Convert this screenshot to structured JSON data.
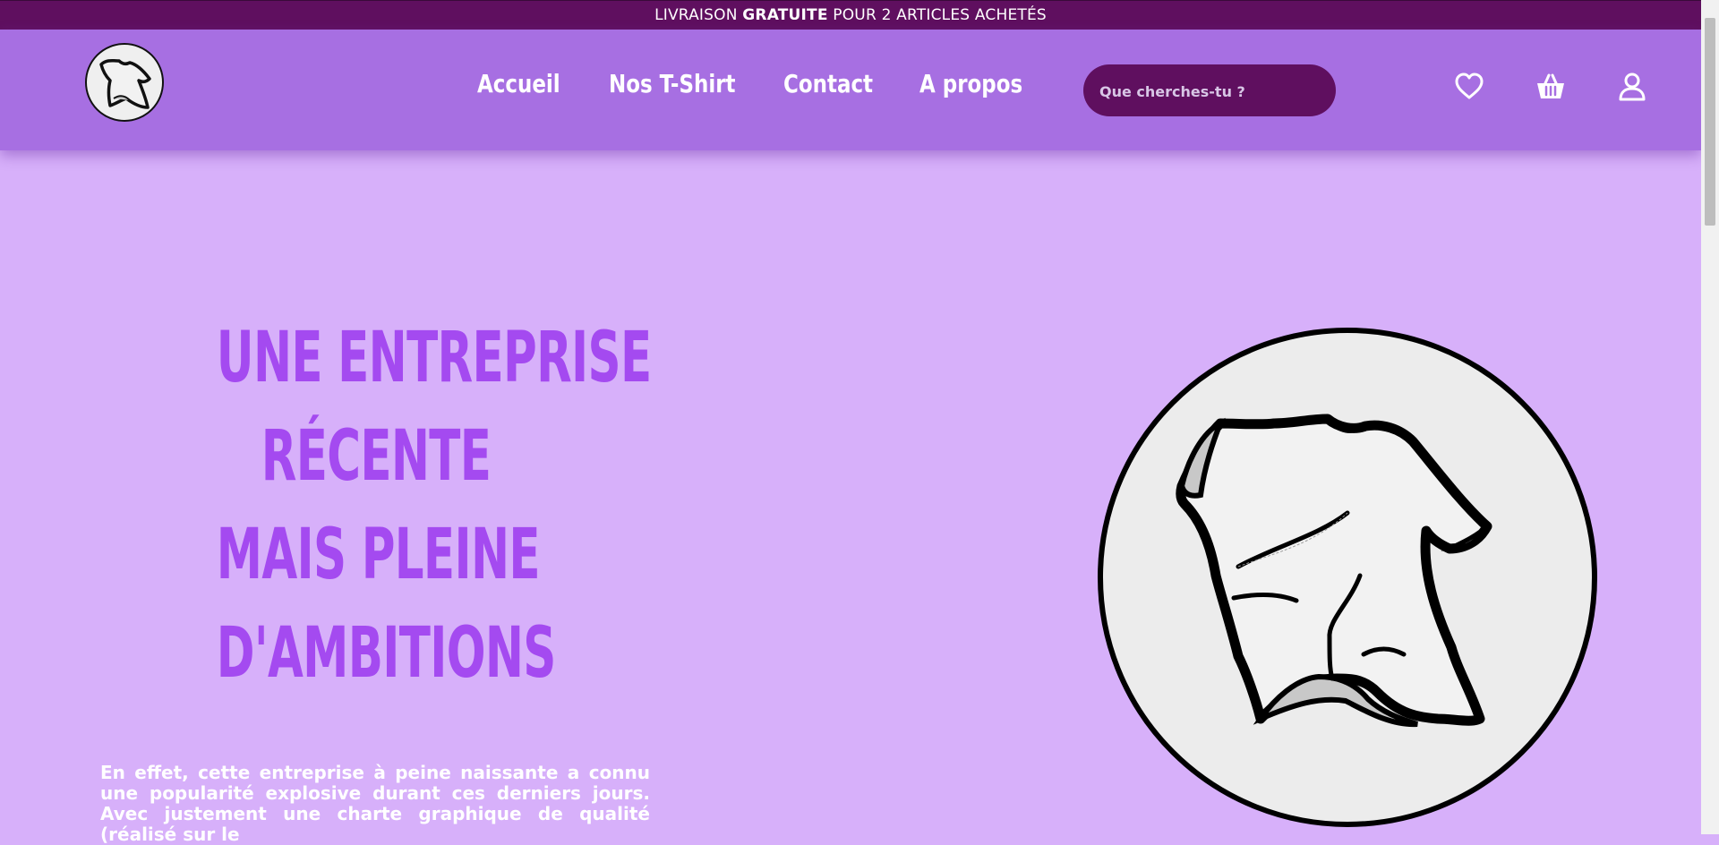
{
  "announcement": {
    "prefix": "LIVRAISON ",
    "highlight": "GRATUITE",
    "suffix": " POUR 2 ARTICLES ACHETÉS"
  },
  "nav": {
    "items": [
      {
        "label": "Accueil"
      },
      {
        "label": "Nos T-Shirt"
      },
      {
        "label": "Contact"
      },
      {
        "label": "A propos"
      }
    ]
  },
  "search": {
    "placeholder": "Que cherches-tu ?",
    "value": ""
  },
  "header_icons": [
    "heart-icon",
    "basket-icon",
    "user-icon"
  ],
  "hero": {
    "title_lines": [
      "UNE ENTREPRISE",
      "RÉCENTE",
      "MAIS PLEINE",
      "D'AMBITIONS"
    ],
    "paragraph": "En effet, cette entreprise à peine naissante a connu une popularité explosive durant ces derniers jours. Avec justement une charte graphique de qualité (réalisé sur le"
  },
  "colors": {
    "background": "#d7b0fa",
    "header": "#a76fe2",
    "topbar": "#5f0f5f",
    "title": "#a44af0",
    "text": "#ffffff"
  }
}
